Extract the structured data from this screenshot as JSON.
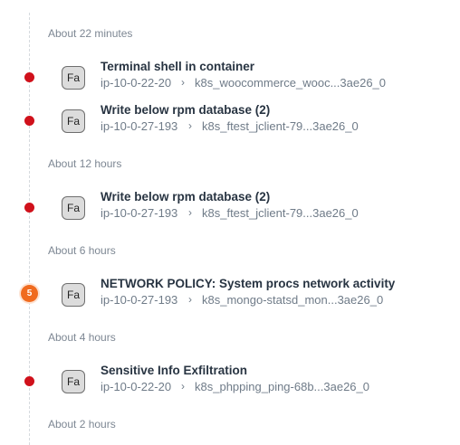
{
  "groups": [
    {
      "label": "About 22 minutes"
    },
    {
      "label": "About 12 hours"
    },
    {
      "label": "About 6 hours"
    },
    {
      "label": "About 4 hours"
    },
    {
      "label": "About 2 hours"
    }
  ],
  "events": [
    {
      "badge": "Fa",
      "title": "Terminal shell in container",
      "host": "ip-10-0-22-20",
      "container": "k8s_woocommerce_wooc...3ae26_0"
    },
    {
      "badge": "Fa",
      "title": "Write below rpm database (2)",
      "host": "ip-10-0-27-193",
      "container": "k8s_ftest_jclient-79...3ae26_0"
    },
    {
      "badge": "Fa",
      "title": "Write below rpm database (2)",
      "host": "ip-10-0-27-193",
      "container": "k8s_ftest_jclient-79...3ae26_0"
    },
    {
      "badge": "Fa",
      "title": "NETWORK POLICY: System procs network activity",
      "host": "ip-10-0-27-193",
      "container": "k8s_mongo-statsd_mon...3ae26_0",
      "count": "5"
    },
    {
      "badge": "Fa",
      "title": "Sensitive Info Exfiltration",
      "host": "ip-10-0-22-20",
      "container": "k8s_phpping_ping-68b...3ae26_0"
    }
  ],
  "separator_icon": "chevron-right-icon",
  "colors": {
    "severity_dot": "#d0111b",
    "count_badge": "#f06b1f"
  }
}
